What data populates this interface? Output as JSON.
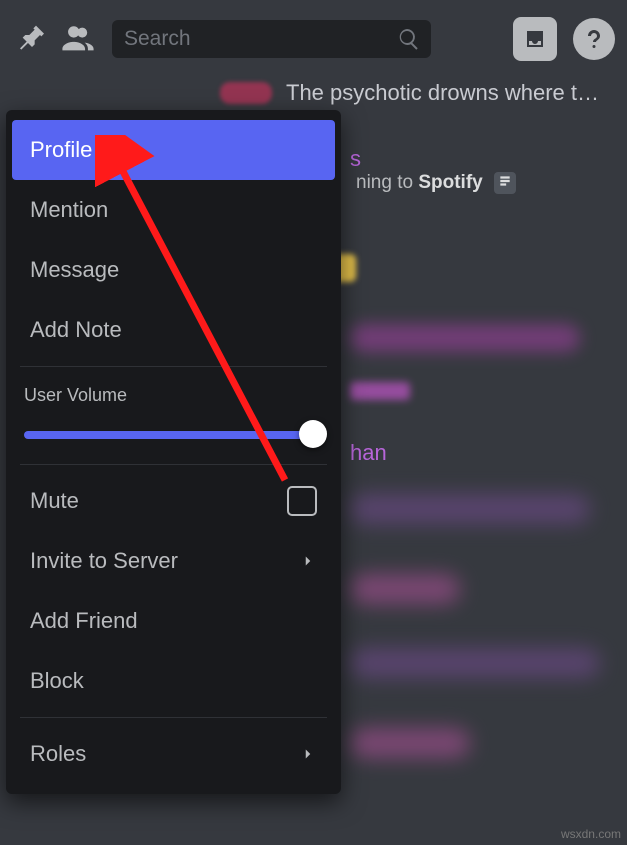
{
  "topbar": {
    "search_placeholder": "Search"
  },
  "context_menu": {
    "profile": "Profile",
    "mention": "Mention",
    "message": "Message",
    "add_note": "Add Note",
    "user_volume": "User Volume",
    "mute": "Mute",
    "invite": "Invite to Server",
    "add_friend": "Add Friend",
    "block": "Block",
    "roles": "Roles"
  },
  "content": {
    "top_text": "The psychotic drowns where t…",
    "listening_prefix": "ning to ",
    "listening_service": "Spotify",
    "name_part": "s",
    "name_part2": "han"
  },
  "watermark": "wsxdn.com"
}
